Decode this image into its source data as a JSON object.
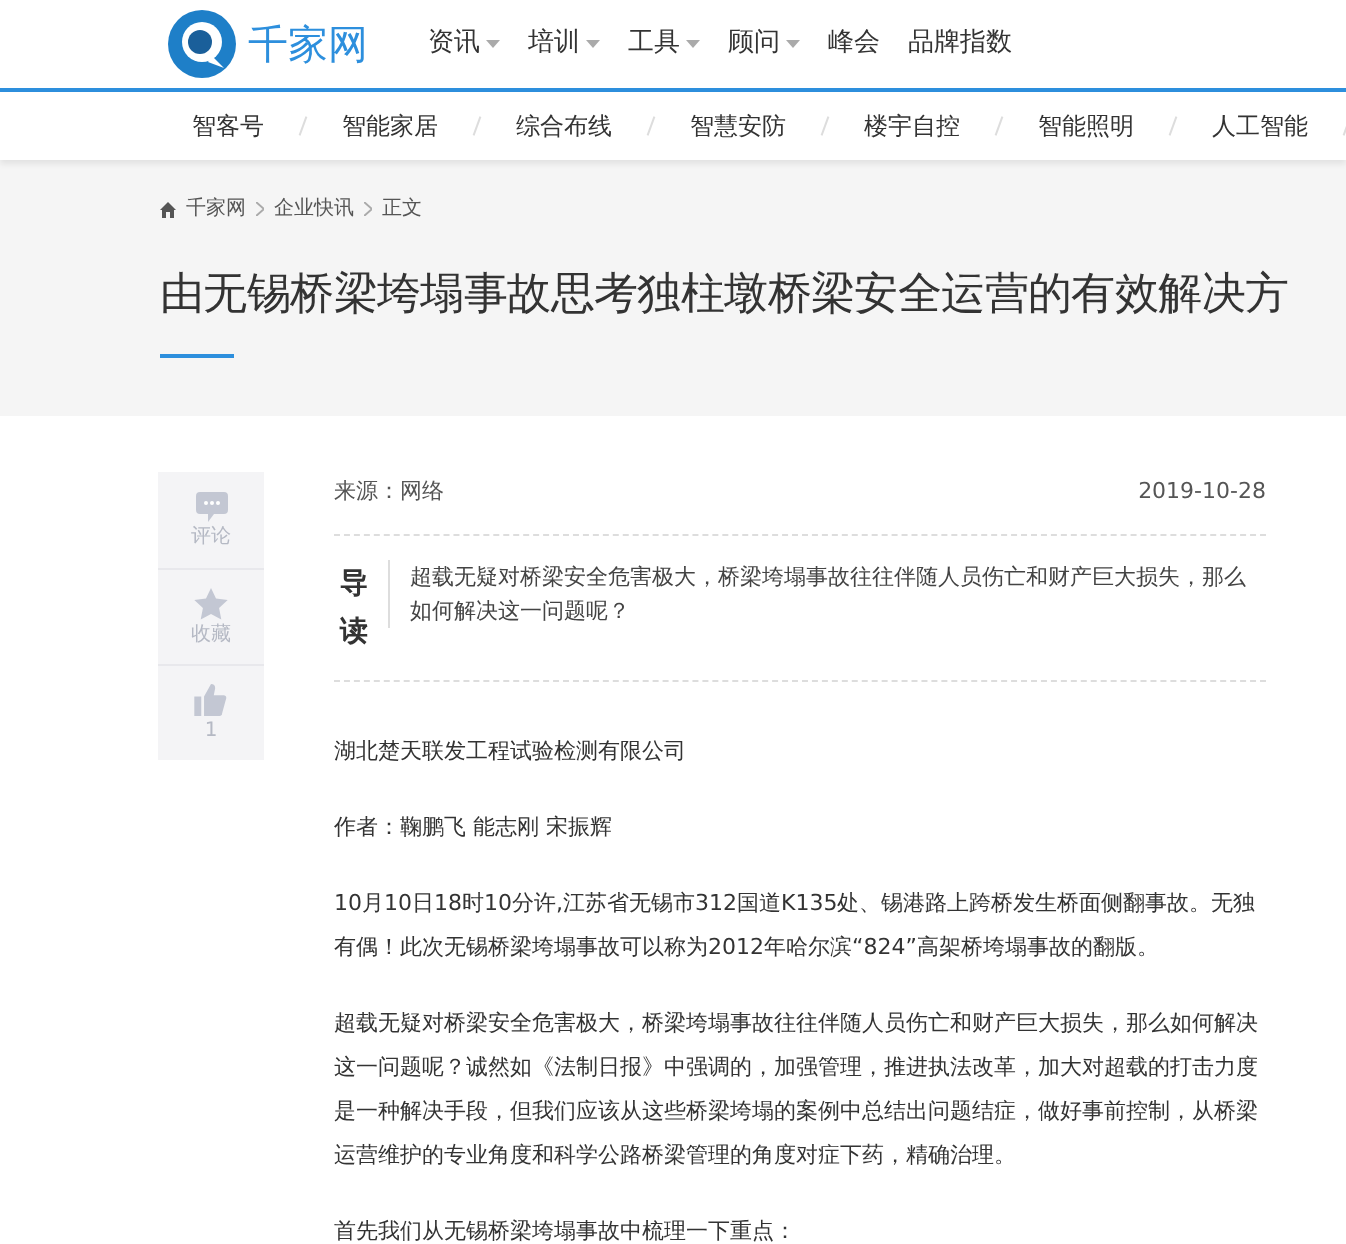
{
  "header": {
    "logo_text": "千家网",
    "nav": [
      {
        "label": "资讯",
        "has_dropdown": true
      },
      {
        "label": "培训",
        "has_dropdown": true
      },
      {
        "label": "工具",
        "has_dropdown": true
      },
      {
        "label": "顾问",
        "has_dropdown": true
      },
      {
        "label": "峰会",
        "has_dropdown": false
      },
      {
        "label": "品牌指数",
        "has_dropdown": false
      }
    ]
  },
  "subnav": [
    "智客号",
    "智能家居",
    "综合布线",
    "智慧安防",
    "楼宇自控",
    "智能照明",
    "人工智能"
  ],
  "breadcrumb": [
    "千家网",
    "企业快讯",
    "正文"
  ],
  "title": "由无锡桥梁垮塌事故思考独柱墩桥梁安全运营的有效解决方",
  "side_actions": [
    {
      "kind": "comment",
      "label": "评论"
    },
    {
      "kind": "favorite",
      "label": "收藏"
    },
    {
      "kind": "like",
      "label": "1"
    }
  ],
  "source": "来源：网络",
  "date": "2019-10-28",
  "lead": {
    "label": "导读",
    "text": "超载无疑对桥梁安全危害极大，桥梁垮塌事故往往伴随人员伤亡和财产巨大损失，那么如何解决这一问题呢？"
  },
  "paragraphs": [
    "湖北楚天联发工程试验检测有限公司",
    "作者：鞠鹏飞 能志刚 宋振辉",
    "10月10日18时10分许,江苏省无锡市312国道K135处、锡港路上跨桥发生桥面侧翻事故。无独有偶！此次无锡桥梁垮塌事故可以称为2012年哈尔滨“824”高架桥垮塌事故的翻版。",
    "超载无疑对桥梁安全危害极大，桥梁垮塌事故往往伴随人员伤亡和财产巨大损失，那么如何解决这一问题呢？诚然如《法制日报》中强调的，加强管理，推进执法改革，加大对超载的打击力度是一种解决手段，但我们应该从这些桥梁垮塌的案例中总结出问题结症，做好事前控制，从桥梁运营维护的专业角度和科学公路桥梁管理的角度对症下药，精确治理。",
    "首先我们从无锡桥梁垮塌事故中梳理一下重点："
  ]
}
